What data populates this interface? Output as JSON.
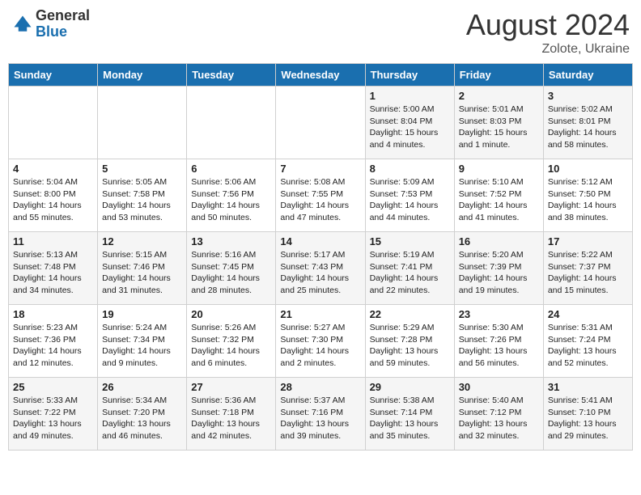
{
  "logo": {
    "general": "General",
    "blue": "Blue"
  },
  "title": {
    "month_year": "August 2024",
    "location": "Zolote, Ukraine"
  },
  "weekdays": [
    "Sunday",
    "Monday",
    "Tuesday",
    "Wednesday",
    "Thursday",
    "Friday",
    "Saturday"
  ],
  "weeks": [
    [
      {
        "day": "",
        "info": ""
      },
      {
        "day": "",
        "info": ""
      },
      {
        "day": "",
        "info": ""
      },
      {
        "day": "",
        "info": ""
      },
      {
        "day": "1",
        "info": "Sunrise: 5:00 AM\nSunset: 8:04 PM\nDaylight: 15 hours\nand 4 minutes."
      },
      {
        "day": "2",
        "info": "Sunrise: 5:01 AM\nSunset: 8:03 PM\nDaylight: 15 hours\nand 1 minute."
      },
      {
        "day": "3",
        "info": "Sunrise: 5:02 AM\nSunset: 8:01 PM\nDaylight: 14 hours\nand 58 minutes."
      }
    ],
    [
      {
        "day": "4",
        "info": "Sunrise: 5:04 AM\nSunset: 8:00 PM\nDaylight: 14 hours\nand 55 minutes."
      },
      {
        "day": "5",
        "info": "Sunrise: 5:05 AM\nSunset: 7:58 PM\nDaylight: 14 hours\nand 53 minutes."
      },
      {
        "day": "6",
        "info": "Sunrise: 5:06 AM\nSunset: 7:56 PM\nDaylight: 14 hours\nand 50 minutes."
      },
      {
        "day": "7",
        "info": "Sunrise: 5:08 AM\nSunset: 7:55 PM\nDaylight: 14 hours\nand 47 minutes."
      },
      {
        "day": "8",
        "info": "Sunrise: 5:09 AM\nSunset: 7:53 PM\nDaylight: 14 hours\nand 44 minutes."
      },
      {
        "day": "9",
        "info": "Sunrise: 5:10 AM\nSunset: 7:52 PM\nDaylight: 14 hours\nand 41 minutes."
      },
      {
        "day": "10",
        "info": "Sunrise: 5:12 AM\nSunset: 7:50 PM\nDaylight: 14 hours\nand 38 minutes."
      }
    ],
    [
      {
        "day": "11",
        "info": "Sunrise: 5:13 AM\nSunset: 7:48 PM\nDaylight: 14 hours\nand 34 minutes."
      },
      {
        "day": "12",
        "info": "Sunrise: 5:15 AM\nSunset: 7:46 PM\nDaylight: 14 hours\nand 31 minutes."
      },
      {
        "day": "13",
        "info": "Sunrise: 5:16 AM\nSunset: 7:45 PM\nDaylight: 14 hours\nand 28 minutes."
      },
      {
        "day": "14",
        "info": "Sunrise: 5:17 AM\nSunset: 7:43 PM\nDaylight: 14 hours\nand 25 minutes."
      },
      {
        "day": "15",
        "info": "Sunrise: 5:19 AM\nSunset: 7:41 PM\nDaylight: 14 hours\nand 22 minutes."
      },
      {
        "day": "16",
        "info": "Sunrise: 5:20 AM\nSunset: 7:39 PM\nDaylight: 14 hours\nand 19 minutes."
      },
      {
        "day": "17",
        "info": "Sunrise: 5:22 AM\nSunset: 7:37 PM\nDaylight: 14 hours\nand 15 minutes."
      }
    ],
    [
      {
        "day": "18",
        "info": "Sunrise: 5:23 AM\nSunset: 7:36 PM\nDaylight: 14 hours\nand 12 minutes."
      },
      {
        "day": "19",
        "info": "Sunrise: 5:24 AM\nSunset: 7:34 PM\nDaylight: 14 hours\nand 9 minutes."
      },
      {
        "day": "20",
        "info": "Sunrise: 5:26 AM\nSunset: 7:32 PM\nDaylight: 14 hours\nand 6 minutes."
      },
      {
        "day": "21",
        "info": "Sunrise: 5:27 AM\nSunset: 7:30 PM\nDaylight: 14 hours\nand 2 minutes."
      },
      {
        "day": "22",
        "info": "Sunrise: 5:29 AM\nSunset: 7:28 PM\nDaylight: 13 hours\nand 59 minutes."
      },
      {
        "day": "23",
        "info": "Sunrise: 5:30 AM\nSunset: 7:26 PM\nDaylight: 13 hours\nand 56 minutes."
      },
      {
        "day": "24",
        "info": "Sunrise: 5:31 AM\nSunset: 7:24 PM\nDaylight: 13 hours\nand 52 minutes."
      }
    ],
    [
      {
        "day": "25",
        "info": "Sunrise: 5:33 AM\nSunset: 7:22 PM\nDaylight: 13 hours\nand 49 minutes."
      },
      {
        "day": "26",
        "info": "Sunrise: 5:34 AM\nSunset: 7:20 PM\nDaylight: 13 hours\nand 46 minutes."
      },
      {
        "day": "27",
        "info": "Sunrise: 5:36 AM\nSunset: 7:18 PM\nDaylight: 13 hours\nand 42 minutes."
      },
      {
        "day": "28",
        "info": "Sunrise: 5:37 AM\nSunset: 7:16 PM\nDaylight: 13 hours\nand 39 minutes."
      },
      {
        "day": "29",
        "info": "Sunrise: 5:38 AM\nSunset: 7:14 PM\nDaylight: 13 hours\nand 35 minutes."
      },
      {
        "day": "30",
        "info": "Sunrise: 5:40 AM\nSunset: 7:12 PM\nDaylight: 13 hours\nand 32 minutes."
      },
      {
        "day": "31",
        "info": "Sunrise: 5:41 AM\nSunset: 7:10 PM\nDaylight: 13 hours\nand 29 minutes."
      }
    ]
  ]
}
